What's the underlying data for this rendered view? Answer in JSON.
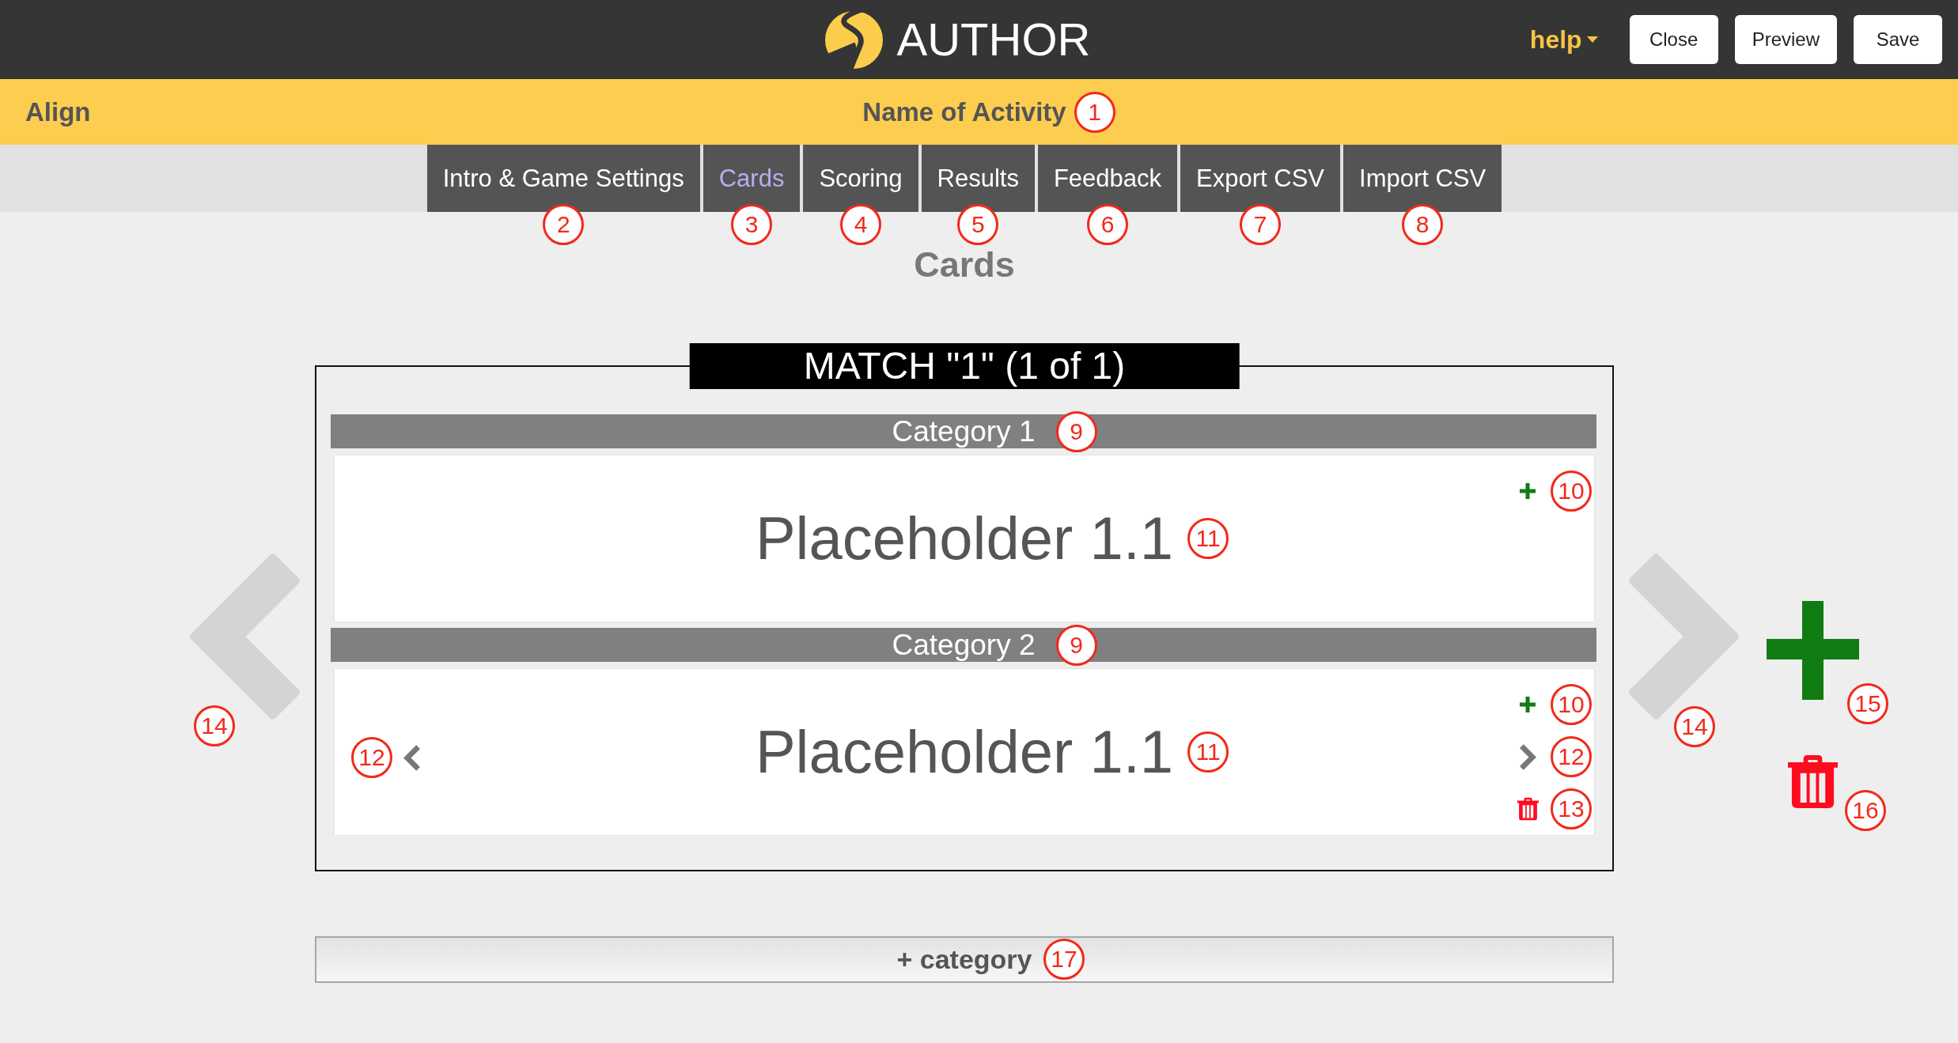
{
  "header": {
    "logo_text": "AUTHOR",
    "help_menu": "help",
    "buttons": [
      "Close",
      "Preview",
      "Save"
    ]
  },
  "activity_bar": {
    "app_name": "Align",
    "title": "Name of Activity",
    "callout": "1"
  },
  "tabs": [
    {
      "label": "Intro & Game Settings",
      "selected": false,
      "callout": "2"
    },
    {
      "label": "Cards",
      "selected": true,
      "callout": "3"
    },
    {
      "label": "Scoring",
      "selected": false,
      "callout": "4"
    },
    {
      "label": "Results",
      "selected": false,
      "callout": "5"
    },
    {
      "label": "Feedback",
      "selected": false,
      "callout": "6"
    },
    {
      "label": "Export CSV",
      "selected": false,
      "callout": "7"
    },
    {
      "label": "Import CSV",
      "selected": false,
      "callout": "8"
    }
  ],
  "page_title": "Cards",
  "match": {
    "title": "MATCH \"1\" (1 of 1)",
    "categories": [
      {
        "name": "Category 1",
        "callout": "9",
        "card": {
          "text": "Placeholder 1.1",
          "callout": "11",
          "controls": [
            {
              "kind": "add",
              "callout": "10"
            }
          ]
        }
      },
      {
        "name": "Category 2",
        "callout": "9",
        "card": {
          "text": "Placeholder 1.1",
          "callout": "11",
          "controls": [
            {
              "kind": "prev",
              "callout": "12"
            },
            {
              "kind": "add",
              "callout": "10"
            },
            {
              "kind": "next",
              "callout": "12"
            },
            {
              "kind": "delete",
              "callout": "13"
            }
          ]
        }
      }
    ],
    "side_controls": [
      {
        "kind": "prev",
        "callout": "14"
      },
      {
        "kind": "next",
        "callout": "14"
      },
      {
        "kind": "add",
        "callout": "15"
      },
      {
        "kind": "delete",
        "callout": "16"
      }
    ]
  },
  "add_category": {
    "label": "+ category",
    "callout": "17"
  }
}
